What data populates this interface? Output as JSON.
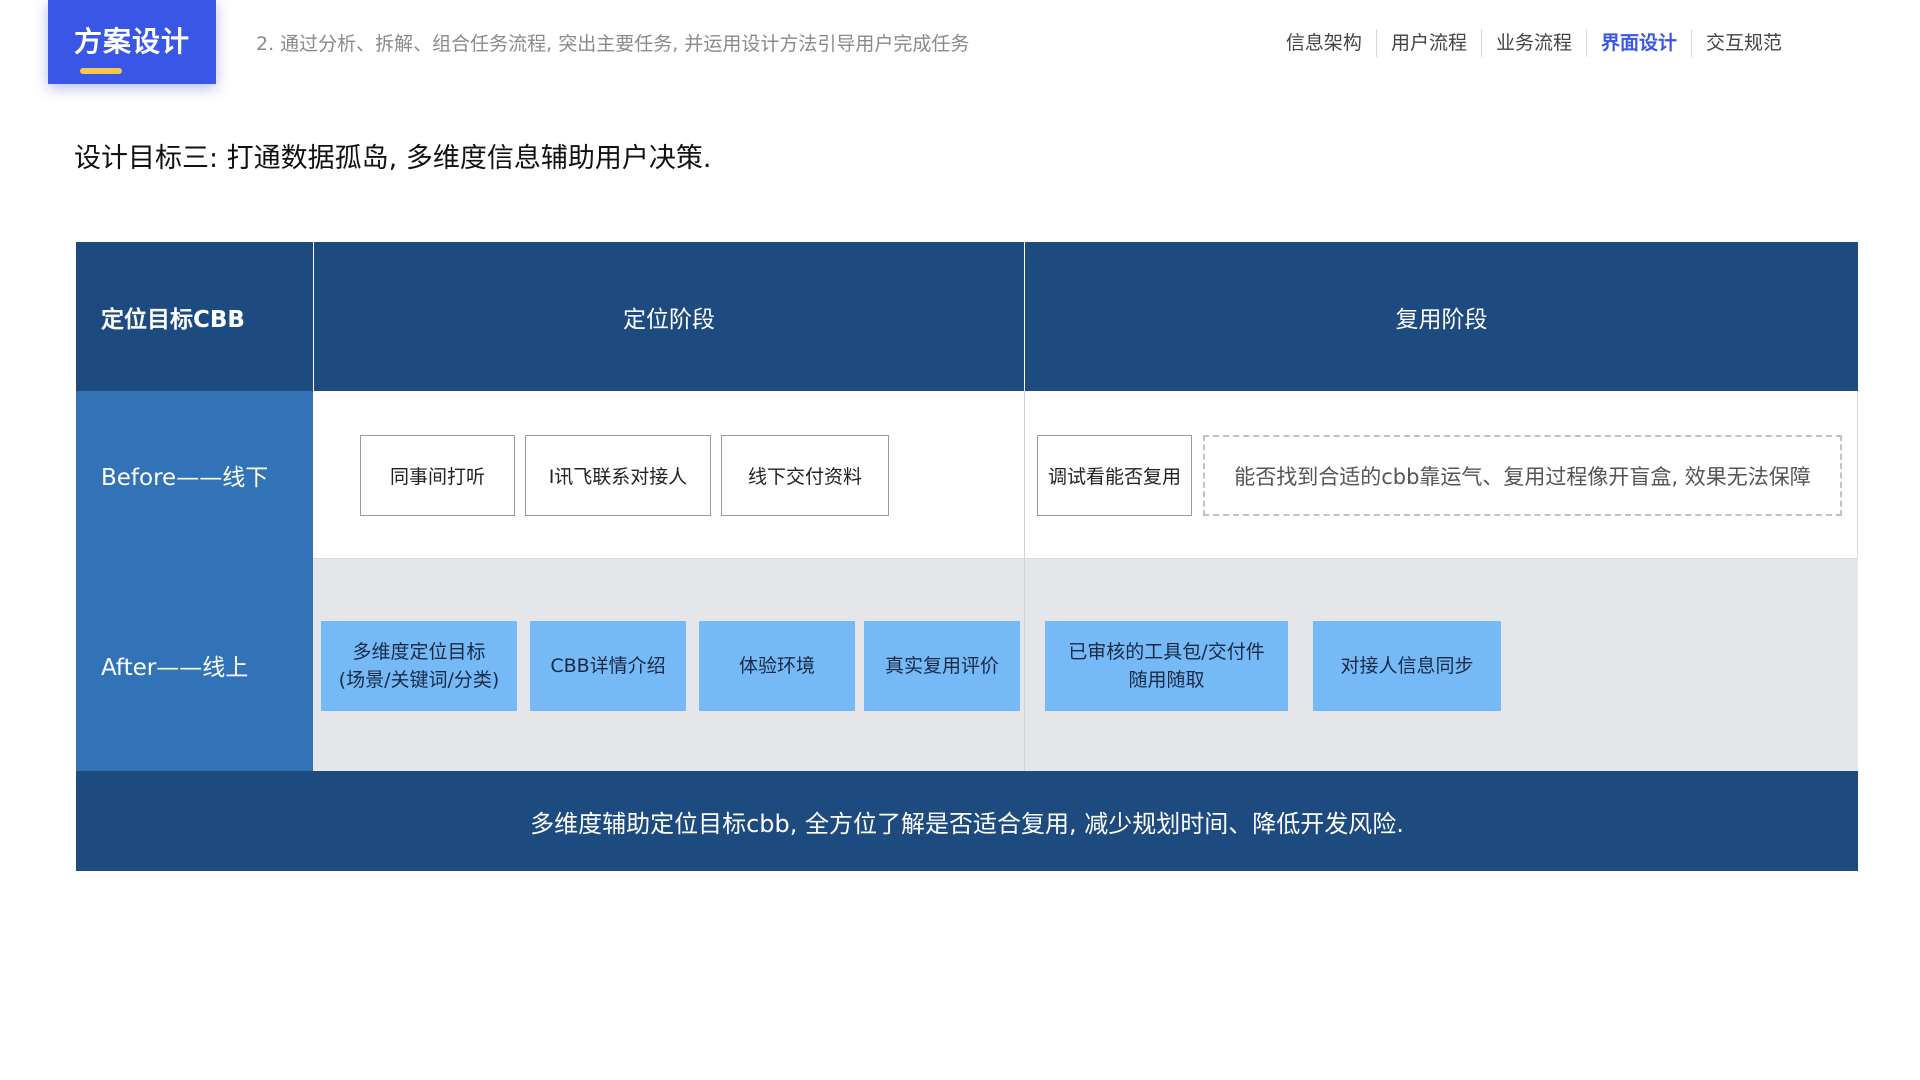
{
  "header": {
    "badge": "方案设计",
    "subtitle": "2. 通过分析、拆解、组合任务流程, 突出主要任务, 并运用设计方法引导用户完成任务",
    "nav": [
      "信息架构",
      "用户流程",
      "业务流程",
      "界面设计",
      "交互规范"
    ],
    "active_nav": "界面设计"
  },
  "heading": "设计目标三: 打通数据孤岛, 多维度信息辅助用户决策.",
  "table": {
    "corner": "定位目标CBB",
    "col1": "定位阶段",
    "col2": "复用阶段",
    "before_label": "Before——线下",
    "after_label": "After——线上",
    "before_locate": [
      "同事间打听",
      "I讯飞联系对接人",
      "线下交付资料"
    ],
    "before_reuse": "调试看能否复用",
    "before_reuse_note": "能否找到合适的cbb靠运气、复用过程像开盲盒, 效果无法保障",
    "after_locate": {
      "b1_line1": "多维度定位目标",
      "b1_line2": "(场景/关键词/分类)",
      "b2": "CBB详情介绍",
      "b3": "体验环境",
      "b4": "真实复用评价"
    },
    "after_reuse": {
      "b1_line1": "已审核的工具包/交付件",
      "b1_line2": "随用随取",
      "b2": "对接人信息同步"
    }
  },
  "footer": "多维度辅助定位目标cbb, 全方位了解是否适合复用, 减少规划时间、降低开发风险.",
  "colors": {
    "accent": "#3a56e6",
    "header_bg": "#1e4b7f",
    "row_label_bg": "#3272b7",
    "after_row_bg": "#e4e6ea",
    "feature_box": "#75baf7",
    "underline": "#f5c84c"
  }
}
